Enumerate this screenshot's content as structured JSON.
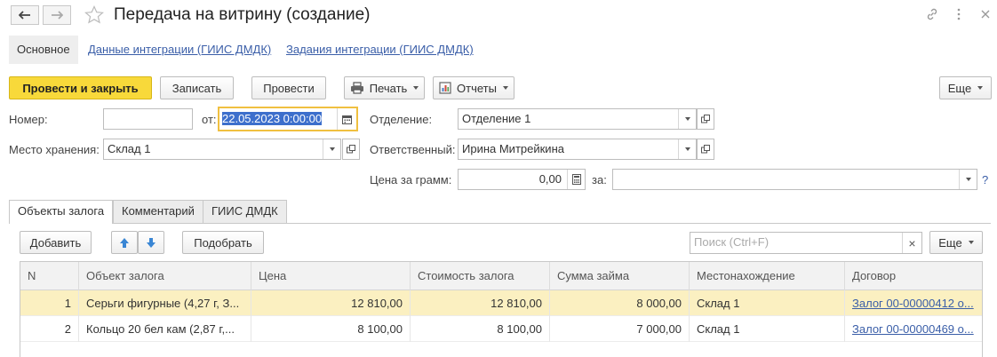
{
  "window": {
    "title": "Передача на витрину (создание)",
    "back_icon": "arrow-left-icon",
    "forward_icon": "arrow-right-icon",
    "favorite_icon": "star-icon"
  },
  "sections": [
    {
      "label": "Основное",
      "active": true
    },
    {
      "label": "Данные интеграции (ГИИС ДМДК)",
      "active": false
    },
    {
      "label": "Задания интеграции (ГИИС ДМДК)",
      "active": false
    }
  ],
  "toolbar": {
    "post_close": "Провести и закрыть",
    "save": "Записать",
    "post": "Провести",
    "print": "Печать",
    "reports": "Отчеты",
    "more": "Еще"
  },
  "form": {
    "number_label": "Номер:",
    "number_value": "",
    "date_label": "от:",
    "date_value": "22.05.2023  0:00:00",
    "branch_label": "Отделение:",
    "branch_value": "Отделение 1",
    "storage_label": "Место хранения:",
    "storage_value": "Склад 1",
    "responsible_label": "Ответственный:",
    "responsible_value": "Ирина Митрейкина",
    "price_label": "Цена за грамм:",
    "price_value": "0,00",
    "for_label": "за:",
    "for_value": "",
    "help": "?"
  },
  "tabs": [
    {
      "label": "Объекты залога",
      "active": true
    },
    {
      "label": "Комментарий",
      "active": false
    },
    {
      "label": "ГИИС ДМДК",
      "active": false
    }
  ],
  "table_toolbar": {
    "add": "Добавить",
    "pick": "Подобрать",
    "search_placeholder": "Поиск (Ctrl+F)",
    "clear": "×",
    "more": "Еще"
  },
  "table": {
    "columns": [
      "N",
      "Объект залога",
      "Цена",
      "Стоимость залога",
      "Сумма займа",
      "Местонахождение",
      "Договор"
    ],
    "rows": [
      {
        "n": "1",
        "object": "Серьги фигурные (4,27 г, З...",
        "price": "12 810,00",
        "value": "12 810,00",
        "loan": "8 000,00",
        "location": "Склад 1",
        "contract": "Залог 00-00000412 о...",
        "selected": true
      },
      {
        "n": "2",
        "object": "Кольцо  20 бел кам (2,87 г,...",
        "price": "8 100,00",
        "value": "8 100,00",
        "loan": "7 000,00",
        "location": "Склад 1",
        "contract": "Залог 00-00000469 о...",
        "selected": false
      }
    ]
  },
  "colors": {
    "accent_yellow": "#f8d93a",
    "link_blue": "#3a5ea8",
    "selected_row": "#fbf0c1",
    "focus_border": "#f0c040"
  }
}
